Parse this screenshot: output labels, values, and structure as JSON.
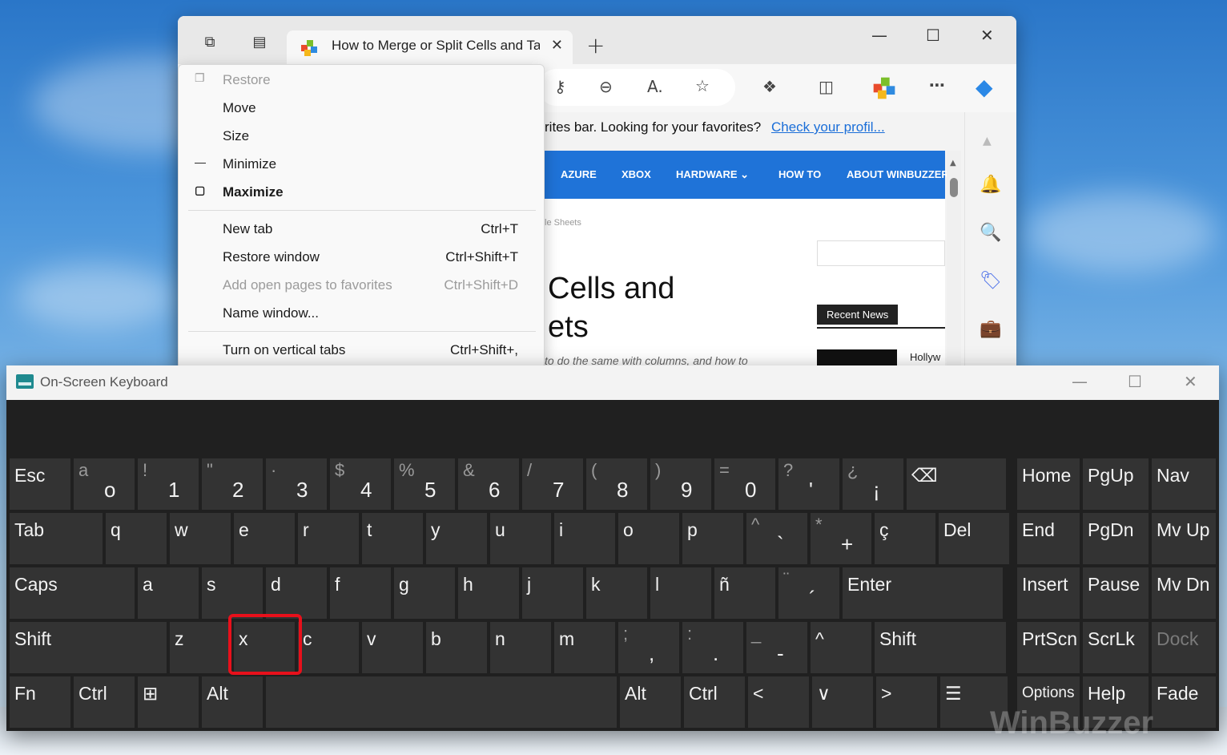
{
  "browser": {
    "tab_title": "How to Merge or Split Cells and Tables in Google Sheets",
    "favorites_bar_text": "rites bar. Looking for your favorites?",
    "favorites_bar_link": "Check your profil...",
    "nav_items": [
      "AZURE",
      "XBOX",
      "HARDWARE ⌄",
      "HOW TO",
      "ABOUT WINBUZZER"
    ],
    "breadcrumb": "le Sheets",
    "headline_lines": [
      "Cells and",
      "ets"
    ],
    "excerpt": "to do the same with columns, and how to",
    "recent_news": "Recent News",
    "recent_item": "Hollyw"
  },
  "context_menu": {
    "items": [
      {
        "label": "Restore",
        "shortcut": "",
        "mark": "❐",
        "disabled": true
      },
      {
        "label": "Move",
        "shortcut": "",
        "mark": "",
        "disabled": false
      },
      {
        "label": "Size",
        "shortcut": "",
        "mark": "",
        "disabled": false
      },
      {
        "label": "Minimize",
        "shortcut": "",
        "mark": "—",
        "disabled": false
      },
      {
        "label": "Maximize",
        "shortcut": "",
        "mark": "▢",
        "disabled": false
      },
      {
        "label": "New tab",
        "shortcut": "Ctrl+T",
        "mark": "",
        "disabled": false
      },
      {
        "label": "Restore window",
        "shortcut": "Ctrl+Shift+T",
        "mark": "",
        "disabled": false
      },
      {
        "label": "Add open pages to favorites",
        "shortcut": "Ctrl+Shift+D",
        "mark": "",
        "disabled": true
      },
      {
        "label": "Name window...",
        "shortcut": "",
        "mark": "",
        "disabled": false
      },
      {
        "label": "Turn on vertical tabs",
        "shortcut": "Ctrl+Shift+,",
        "mark": "",
        "disabled": false
      }
    ]
  },
  "osk": {
    "title": "On-Screen Keyboard",
    "rows": [
      [
        {
          "l": "Esc"
        },
        {
          "t": "a",
          "m": "o"
        },
        {
          "t": "!",
          "m": "1"
        },
        {
          "t": "\"",
          "m": "2"
        },
        {
          "t": "·",
          "m": "3"
        },
        {
          "t": "$",
          "m": "4"
        },
        {
          "t": "%",
          "m": "5"
        },
        {
          "t": "&",
          "m": "6"
        },
        {
          "t": "/",
          "m": "7"
        },
        {
          "t": "(",
          "m": "8"
        },
        {
          "t": ")",
          "m": "9"
        },
        {
          "t": "=",
          "m": "0"
        },
        {
          "t": "?",
          "m": "'"
        },
        {
          "t": "¿",
          "m": "¡"
        },
        {
          "l": "⌫"
        }
      ],
      [
        {
          "l": "Tab"
        },
        {
          "l": "q"
        },
        {
          "l": "w"
        },
        {
          "l": "e"
        },
        {
          "l": "r"
        },
        {
          "l": "t"
        },
        {
          "l": "y"
        },
        {
          "l": "u"
        },
        {
          "l": "i"
        },
        {
          "l": "o"
        },
        {
          "l": "p"
        },
        {
          "t": "^",
          "m": "`"
        },
        {
          "t": "*",
          "m": "+"
        },
        {
          "l": "ç"
        },
        {
          "l": "Del"
        }
      ],
      [
        {
          "l": "Caps"
        },
        {
          "l": "a"
        },
        {
          "l": "s"
        },
        {
          "l": "d"
        },
        {
          "l": "f"
        },
        {
          "l": "g"
        },
        {
          "l": "h"
        },
        {
          "l": "j"
        },
        {
          "l": "k"
        },
        {
          "l": "l"
        },
        {
          "l": "ñ"
        },
        {
          "t": "¨",
          "m": "´"
        },
        {
          "l": "Enter"
        }
      ],
      [
        {
          "l": "Shift"
        },
        {
          "l": "z"
        },
        {
          "l": "x"
        },
        {
          "l": "c"
        },
        {
          "l": "v"
        },
        {
          "l": "b"
        },
        {
          "l": "n"
        },
        {
          "l": "m"
        },
        {
          "t": ";",
          "m": ","
        },
        {
          "t": ":",
          "m": "."
        },
        {
          "t": "_",
          "m": "-"
        },
        {
          "l": "^"
        },
        {
          "l": "Shift"
        }
      ],
      [
        {
          "l": "Fn"
        },
        {
          "l": "Ctrl"
        },
        {
          "l": "⊞"
        },
        {
          "l": "Alt"
        },
        {
          "l": ""
        },
        {
          "l": "Alt"
        },
        {
          "l": "Ctrl"
        },
        {
          "l": "<"
        },
        {
          "l": "∨"
        },
        {
          "l": ">"
        },
        {
          "l": "☰"
        }
      ]
    ],
    "right_rows": [
      [
        "Home",
        "PgUp",
        "Nav"
      ],
      [
        "End",
        "PgDn",
        "Mv Up"
      ],
      [
        "Insert",
        "Pause",
        "Mv Dn"
      ],
      [
        "PrtScn",
        "ScrLk",
        "Dock"
      ],
      [
        "Options",
        "Help",
        "Fade"
      ]
    ]
  },
  "watermark": "WinBuzzer"
}
